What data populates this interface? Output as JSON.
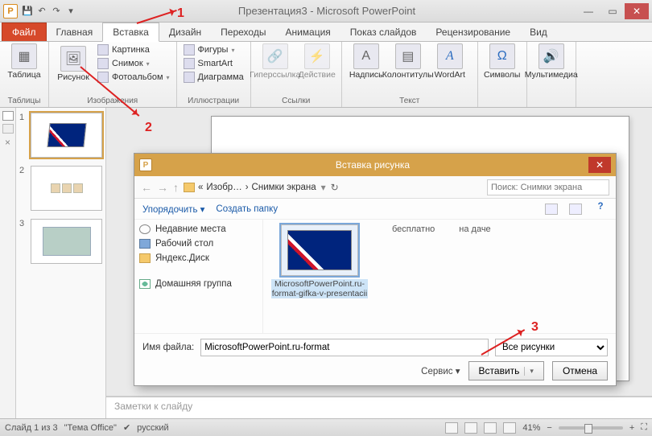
{
  "window": {
    "title": "Презентация3 - Microsoft PowerPoint",
    "qat": {
      "save": "💾",
      "undo": "↶",
      "redo": "↷"
    },
    "ctrl": {
      "min": "—",
      "max": "▭",
      "close": "✕"
    }
  },
  "tabs": {
    "file": "Файл",
    "items": [
      "Главная",
      "Вставка",
      "Дизайн",
      "Переходы",
      "Анимация",
      "Показ слайдов",
      "Рецензирование",
      "Вид"
    ],
    "active_index": 1
  },
  "ribbon": {
    "tables": {
      "label": "Таблицы",
      "table": "Таблица"
    },
    "images": {
      "label": "Изображения",
      "picture": "Рисунок",
      "clipart": "Картинка",
      "screenshot": "Снимок",
      "album": "Фотоальбом"
    },
    "illustrations": {
      "label": "Иллюстрации",
      "shapes": "Фигуры",
      "smartart": "SmartArt",
      "chart": "Диаграмма"
    },
    "links": {
      "label": "Ссылки",
      "hyperlink": "Гиперссылка",
      "action": "Действие"
    },
    "text": {
      "label": "Текст",
      "textbox": "Надпись",
      "headerfooter": "Колонтитулы",
      "wordart": "WordArt"
    },
    "symbols": {
      "label": "",
      "symbols": "Символы"
    },
    "media": {
      "label": "",
      "media": "Мультимедиа"
    }
  },
  "thumbs": {
    "n1": "1",
    "n2": "2",
    "n3": "3"
  },
  "notes": "Заметки к слайду",
  "statusbar": {
    "slide": "Слайд 1 из 3",
    "theme": "\"Тема Office\"",
    "lang": "русский",
    "zoom": "41%"
  },
  "annotations": {
    "one": "1",
    "two": "2",
    "three": "3"
  },
  "dialog": {
    "title": "Вставка рисунка",
    "breadcrumb": {
      "a": "Изобр…",
      "b": "Снимки экрана"
    },
    "search_placeholder": "Поиск: Снимки экрана",
    "toolbar": {
      "organize": "Упорядочить",
      "newfolder": "Создать папку"
    },
    "tree": {
      "recent": "Недавние места",
      "desktop": "Рабочий стол",
      "yadisk": "Яндекс.Диск",
      "homegroup": "Домашняя группа"
    },
    "files": {
      "f1": "MicrosoftPowerPoint.ru-format-gifka-v-presentacii",
      "l2": "бесплатно",
      "l3": "на даче"
    },
    "filename_label": "Имя файла:",
    "filename_value": "MicrosoftPowerPoint.ru-format",
    "filter": "Все рисунки",
    "service": "Сервис",
    "insert": "Вставить",
    "cancel": "Отмена"
  }
}
